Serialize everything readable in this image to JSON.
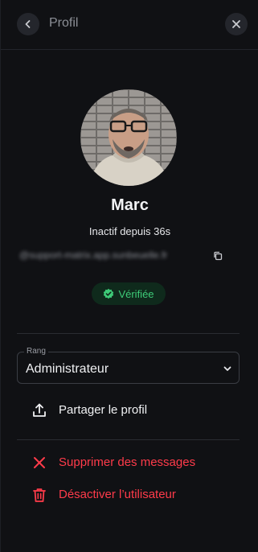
{
  "header": {
    "title": "Profil",
    "back_icon": "chevron-left-icon",
    "close_icon": "close-icon"
  },
  "profile": {
    "name": "Marc",
    "status": "Inactif depuis 36s",
    "handle": "@support-matrix.app.sunbeuelle.fr",
    "verified_label": "Vérifiée"
  },
  "rank": {
    "legend": "Rang",
    "value": "Administrateur"
  },
  "actions": {
    "share": "Partager le profil",
    "delete_messages": "Supprimer des messages",
    "deactivate": "Désactiver l’utilisateur"
  },
  "colors": {
    "danger": "#ff3b4a",
    "verified": "#3ecb78",
    "background": "#101114"
  }
}
